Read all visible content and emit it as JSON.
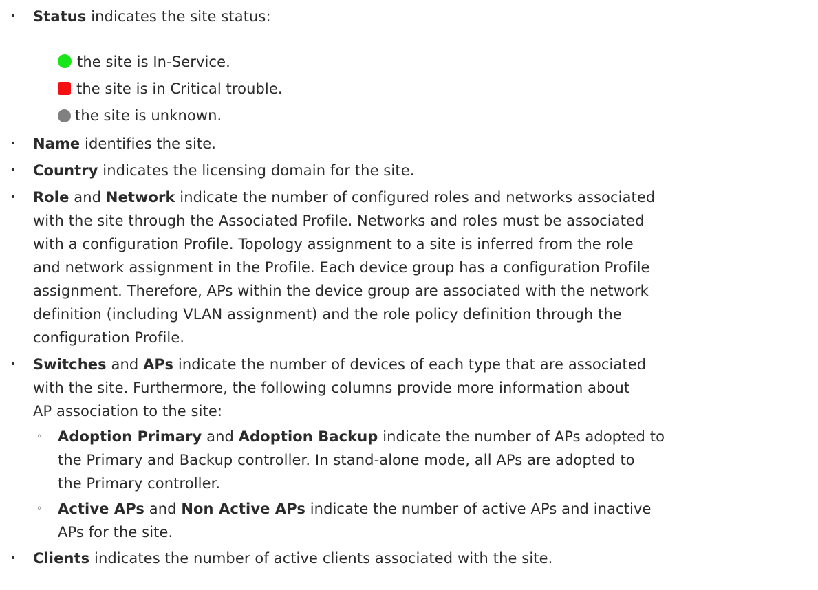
{
  "bullet_glyph": "•",
  "sub_bullet_glyph": "◦",
  "status": {
    "term": "Status",
    "desc": " indicates the site status:",
    "states": [
      {
        "icon": "green-circle-icon",
        "color": "#19e51a",
        "text": "the site is In-Service."
      },
      {
        "icon": "red-square-icon",
        "color": "#f41010",
        "text": "the site is in Critical trouble."
      },
      {
        "icon": "gray-circle-icon",
        "color": "#808080",
        "text": "the site is unknown."
      }
    ]
  },
  "name": {
    "term": "Name",
    "desc": " identifies the site."
  },
  "country": {
    "term": "Country",
    "desc": " indicates the licensing domain for the site."
  },
  "role_network": {
    "term1": "Role",
    "and": " and ",
    "term2": "Network",
    "lines": [
      " indicate the number of configured roles and networks associated",
      "with the site through the Associated Profile. Networks and roles must be associated",
      "with a configuration Profile. Topology assignment to a site is inferred from the role",
      "and network assignment in the Profile. Each device group has a configuration Profile",
      "assignment. Therefore, APs within the device group are associated with the network",
      "definition (including VLAN assignment) and the role policy definition through the",
      "configuration Profile."
    ]
  },
  "switches_aps": {
    "term1": "Switches",
    "and": " and ",
    "term2": "APs",
    "lines": [
      " indicate the number of devices of each type that are associated",
      "with the site. Furthermore, the following columns provide more information about",
      "AP association to the site:"
    ],
    "sub_items": [
      {
        "term1": "Adoption Primary",
        "and": " and ",
        "term2": "Adoption Backup",
        "lines": [
          " indicate the number of APs adopted to",
          "the Primary and Backup controller. In stand-alone mode, all APs are adopted to",
          "the Primary controller."
        ]
      },
      {
        "term1": "Active APs",
        "and": " and ",
        "term2": "Non Active APs",
        "lines": [
          " indicate the number of active APs and inactive",
          "APs for the site."
        ]
      }
    ]
  },
  "clients": {
    "term": "Clients",
    "desc": " indicates the number of active clients associated with the site."
  }
}
